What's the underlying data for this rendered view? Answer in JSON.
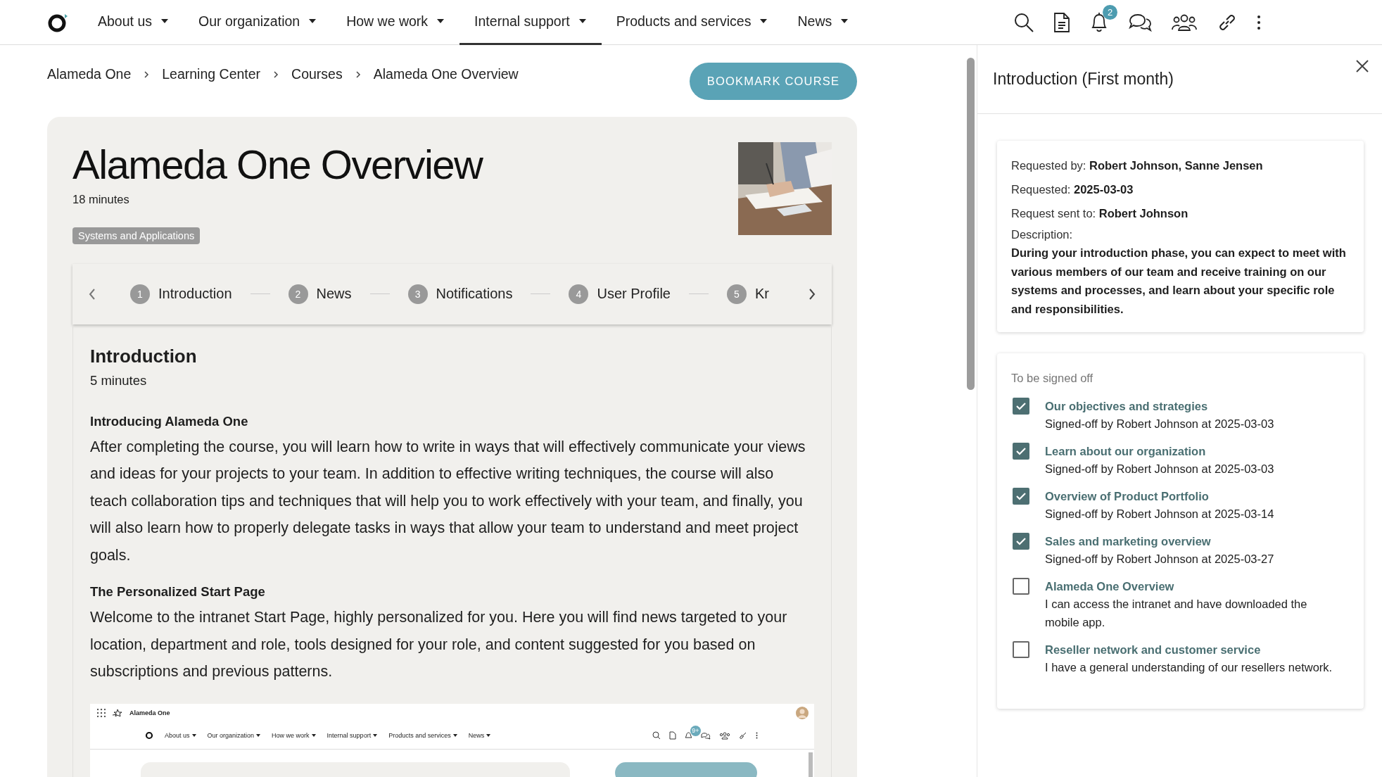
{
  "nav": {
    "items": [
      {
        "label": "About us",
        "selected": false
      },
      {
        "label": "Our organization",
        "selected": false
      },
      {
        "label": "How we work",
        "selected": false
      },
      {
        "label": "Internal support",
        "selected": true
      },
      {
        "label": "Products and services",
        "selected": false
      },
      {
        "label": "News",
        "selected": false
      }
    ],
    "notification_count": "2"
  },
  "breadcrumb": [
    "Alameda One",
    "Learning Center",
    "Courses",
    "Alameda One Overview"
  ],
  "bookmark_button": "BOOKMARK COURSE",
  "course": {
    "title": "Alameda One Overview",
    "duration": "18 minutes",
    "tag": "Systems and Applications"
  },
  "stepper": {
    "steps": [
      {
        "number": "1",
        "label": "Introduction"
      },
      {
        "number": "2",
        "label": "News"
      },
      {
        "number": "3",
        "label": "Notifications"
      },
      {
        "number": "4",
        "label": "User Profile"
      },
      {
        "number": "5",
        "label": "Kr"
      }
    ]
  },
  "section": {
    "title": "Introduction",
    "duration": "5 minutes",
    "blocks": [
      {
        "heading": "Introducing Alameda One",
        "text": "After completing the course, you will learn how to write in ways that will effectively communicate your views and ideas for your projects to your team. In addition to effective writing techniques, the course will also teach collaboration tips and techniques that will help you to work effectively with your team, and finally, you will also learn how to properly delegate tasks in ways that allow your team to understand and meet project goals."
      },
      {
        "heading": "The Personalized Start Page",
        "text": "Welcome to the intranet Start Page, highly personalized for you. Here you will find news targeted to your location, department and role, tools designed for your role, and content suggested for you based on subscriptions and previous patterns."
      }
    ]
  },
  "embedded_screenshot": {
    "app_name": "Alameda One",
    "nav_items": [
      "About us",
      "Our organization",
      "How we work",
      "Internal support",
      "Products and services",
      "News"
    ],
    "notification_count": "9+"
  },
  "panel": {
    "title": "Introduction (First month)",
    "details": [
      {
        "label": "Requested by:",
        "value": "Robert Johnson, Sanne Jensen"
      },
      {
        "label": "Requested:",
        "value": "2025-03-03"
      },
      {
        "label": "Request sent to:",
        "value": "Robert Johnson"
      }
    ],
    "description_label": "Description:",
    "description": "During your introduction phase, you can expect to meet with various members of our team and receive training on our systems and processes, and learn about your specific role and responsibilities.",
    "signoff_title": "To be signed off",
    "items": [
      {
        "title": "Our objectives and strategies",
        "note": "Signed-off by Robert Johnson at 2025-03-03",
        "checked": true
      },
      {
        "title": "Learn about our organization",
        "note": "Signed-off by Robert Johnson at 2025-03-03",
        "checked": true
      },
      {
        "title": "Overview of Product Portfolio",
        "note": "Signed-off by Robert Johnson at 2025-03-14",
        "checked": true
      },
      {
        "title": "Sales and marketing overview",
        "note": "Signed-off by Robert Johnson at 2025-03-27",
        "checked": true
      },
      {
        "title": "Alameda One Overview",
        "note": "I can access the intranet and have downloaded the mobile app.",
        "checked": false
      },
      {
        "title": "Reseller network and customer service",
        "note": "I have a general understanding of our resellers network.",
        "checked": false
      }
    ]
  }
}
